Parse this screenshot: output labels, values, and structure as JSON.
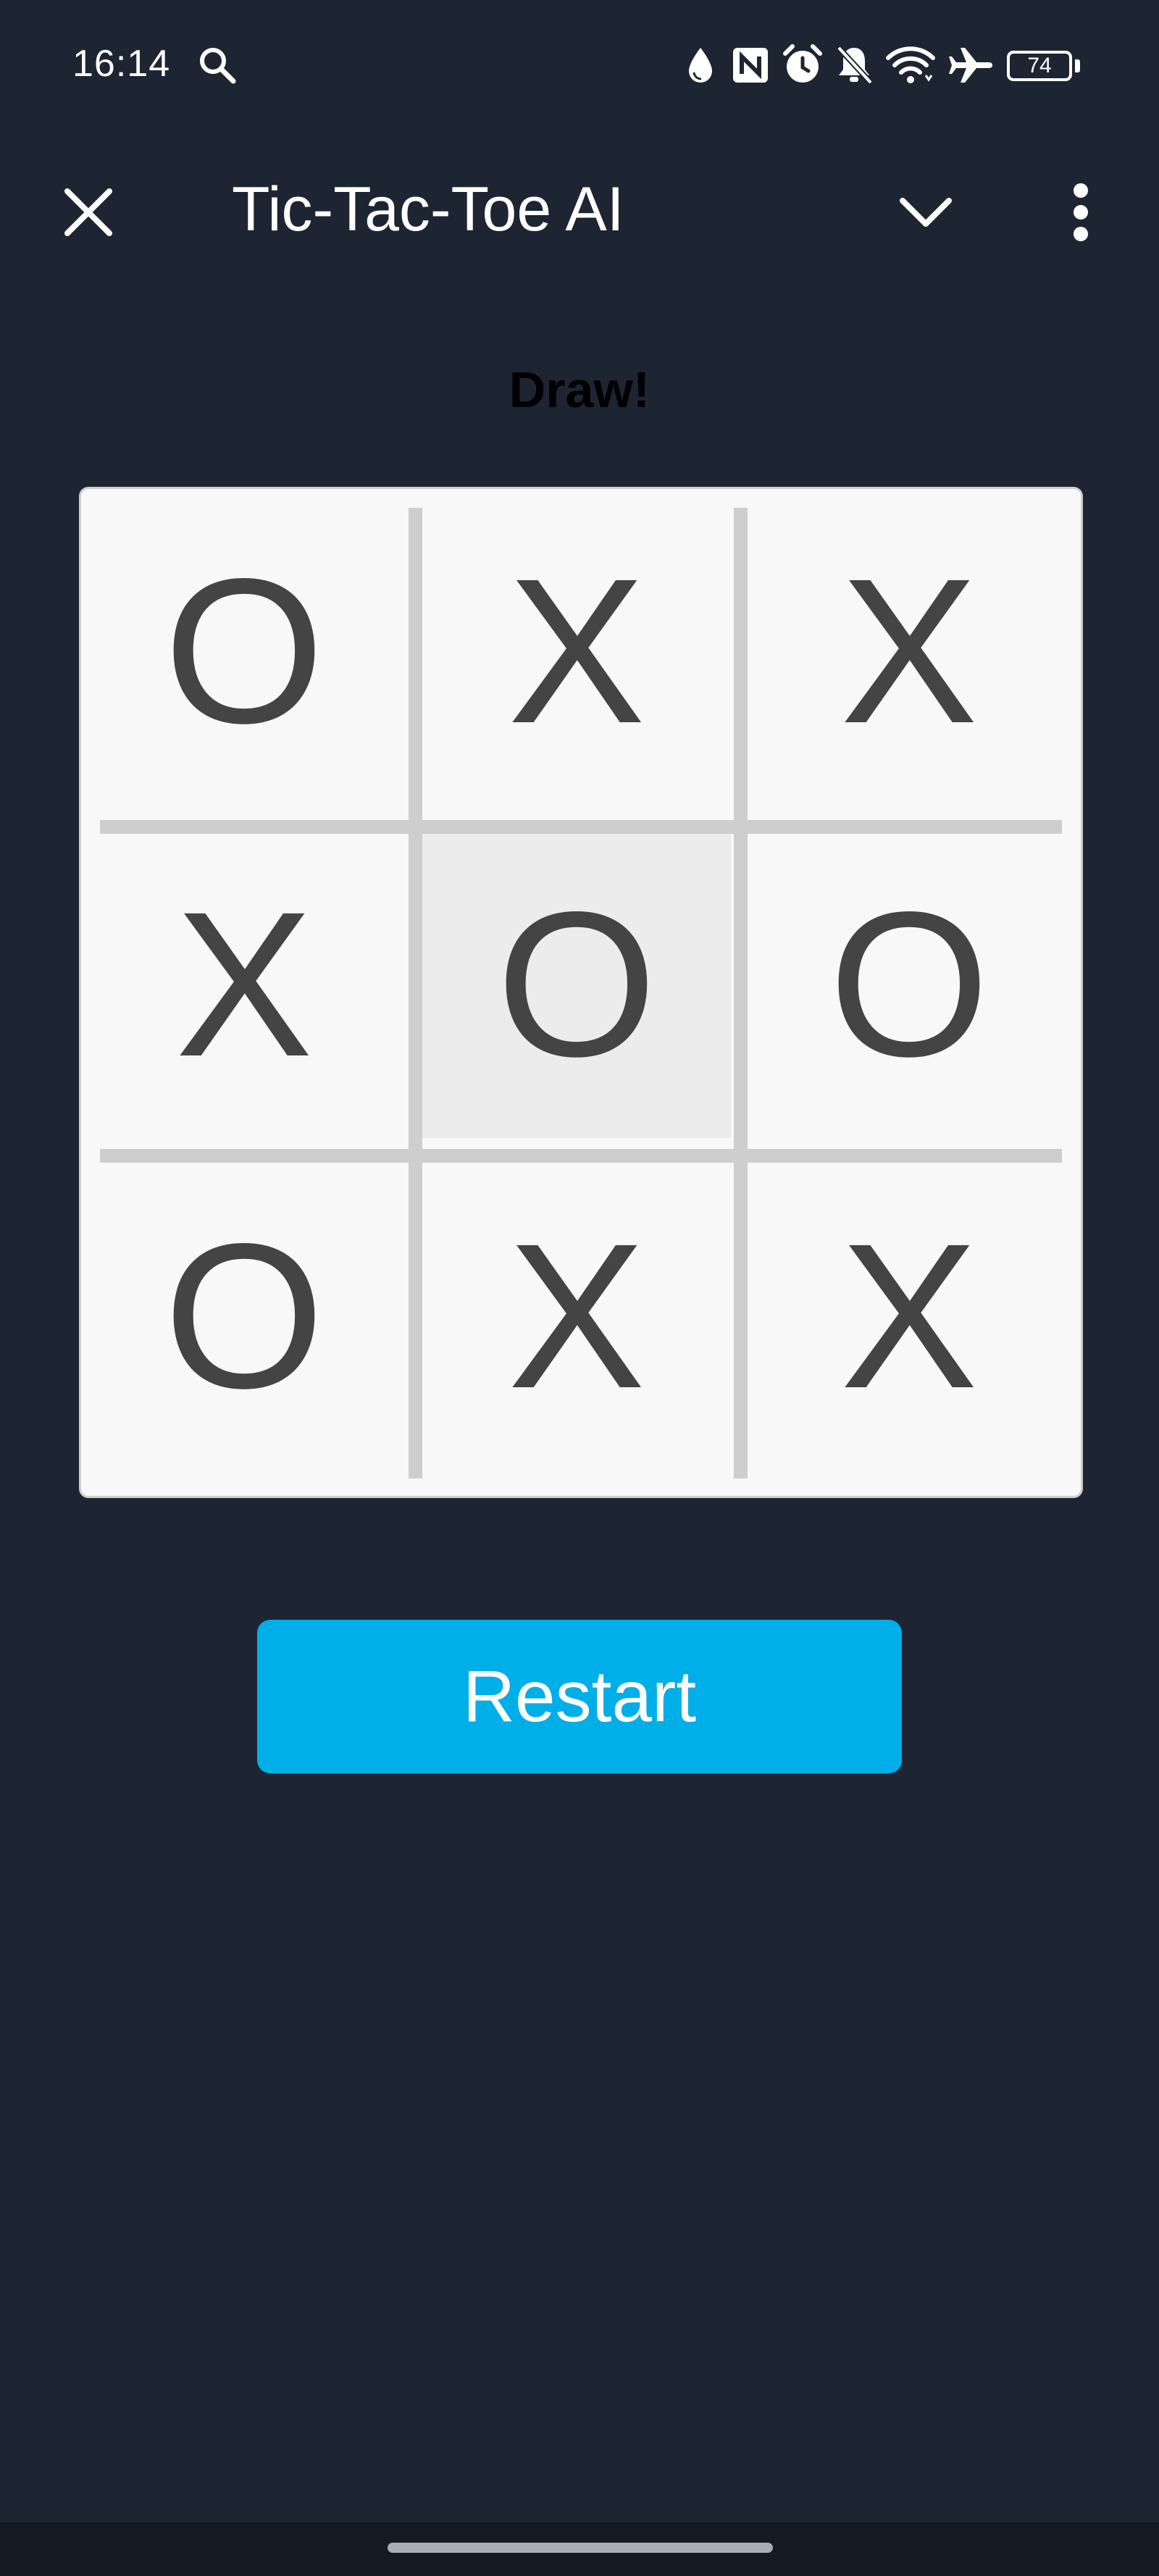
{
  "status_bar": {
    "time": "16:14",
    "battery": "74",
    "icons": [
      "search-icon",
      "water-drop-icon",
      "nfc-icon",
      "alarm-icon",
      "mute-icon",
      "wifi-icon",
      "airplane-icon",
      "battery-icon"
    ]
  },
  "app_bar": {
    "title": "Tic-Tac-Toe AI",
    "icons": [
      "close-icon",
      "chevron-down-icon",
      "more-vert-icon"
    ]
  },
  "game": {
    "status": "Draw!",
    "cells": [
      "O",
      "X",
      "X",
      "X",
      "O",
      "O",
      "O",
      "X",
      "X"
    ],
    "highlighted_cell": 4
  },
  "restart_label": "Restart",
  "colors": {
    "background": "#1e2532",
    "board": "#f8f8f8",
    "grid_line": "#cecece",
    "mark": "#444444",
    "highlight": "#ececec",
    "button": "#00aee8"
  }
}
